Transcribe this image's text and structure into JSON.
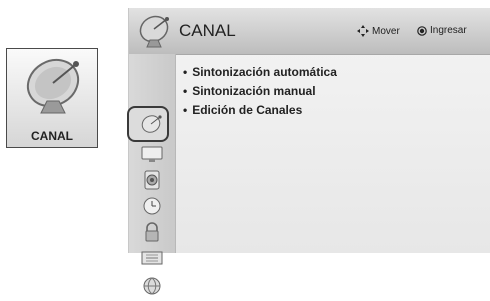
{
  "card": {
    "label": "CANAL"
  },
  "header": {
    "title": "CANAL",
    "move_label": "Mover",
    "enter_label": "Ingresar"
  },
  "sidebar": {
    "icons": [
      "satellite-dish-icon",
      "tv-screen-icon",
      "speaker-icon",
      "clock-icon",
      "lock-icon",
      "input-icon",
      "globe-icon"
    ]
  },
  "menu": {
    "items": [
      {
        "label": "Sintonización automática"
      },
      {
        "label": "Sintonización manual"
      },
      {
        "label": "Edición de Canales"
      }
    ]
  }
}
